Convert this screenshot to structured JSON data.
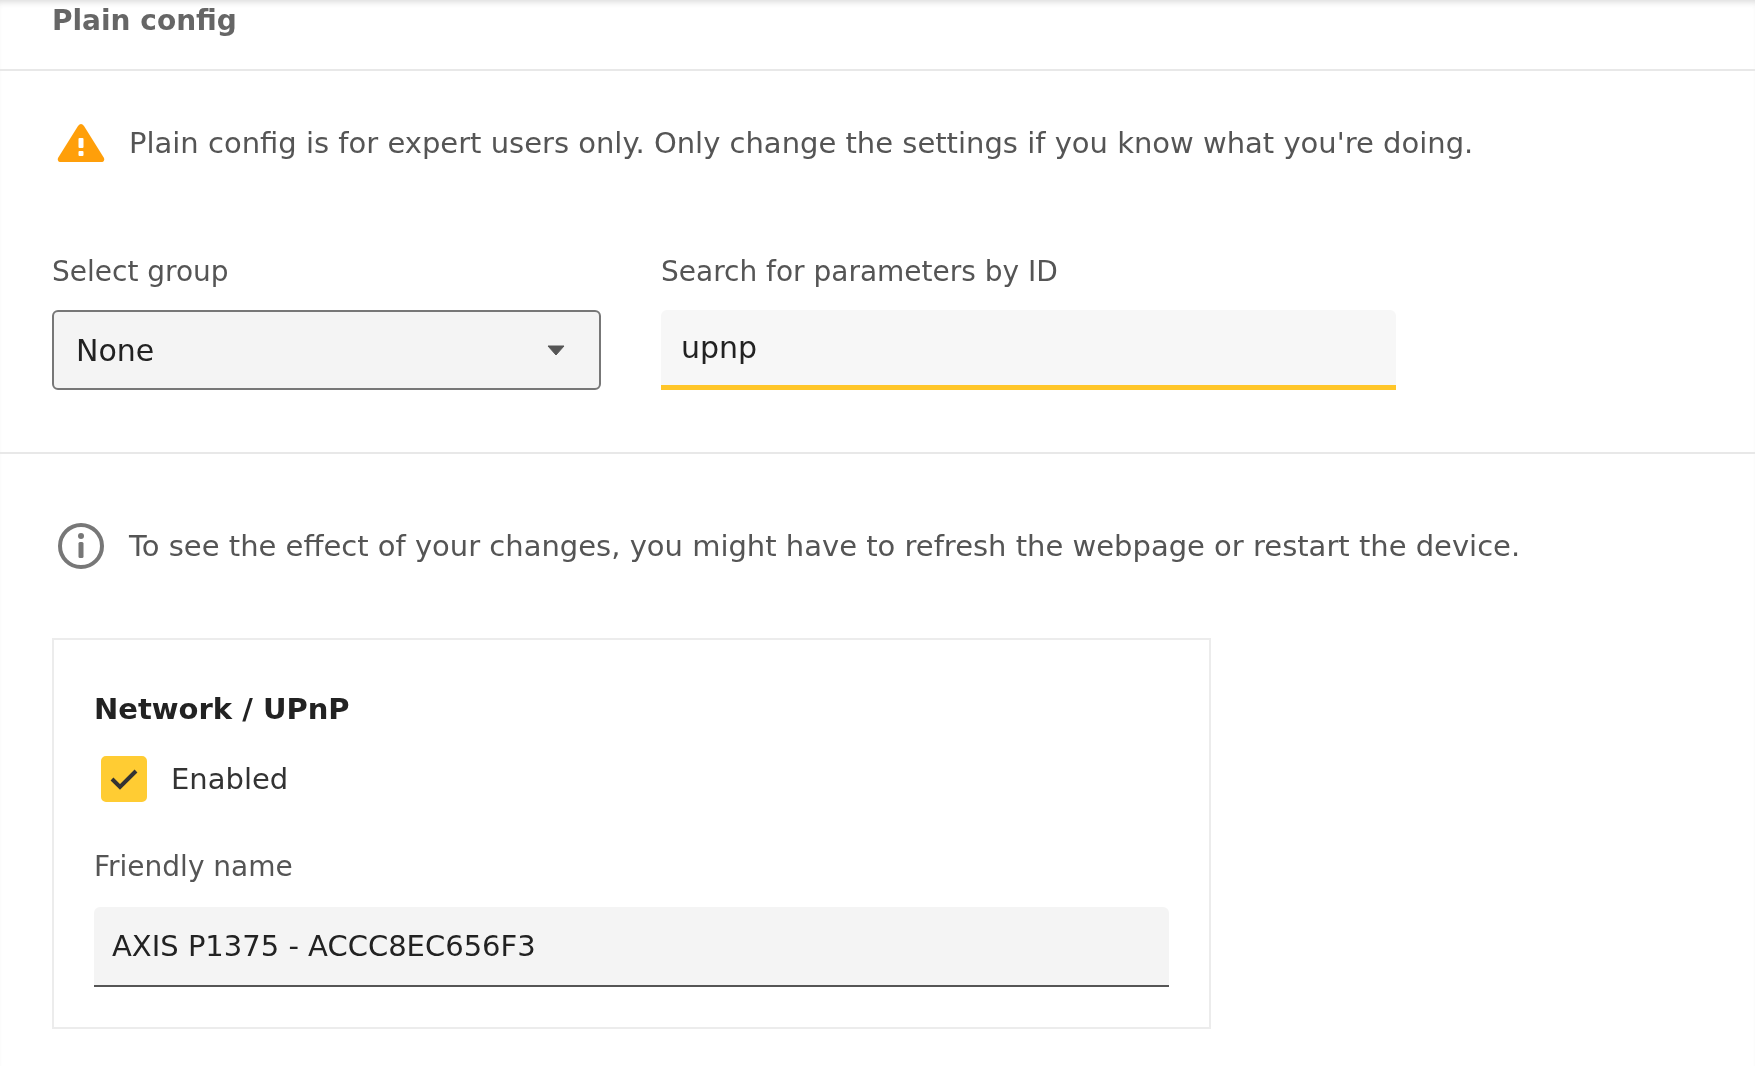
{
  "header": {
    "title": "Plain config"
  },
  "warning": {
    "text": "Plain config is for expert users only. Only change the settings if you know what you're doing."
  },
  "group_select": {
    "label": "Select group",
    "value": "None"
  },
  "search": {
    "label": "Search for parameters by ID",
    "value": "upnp",
    "focused": true
  },
  "info": {
    "text": "To see the effect of your changes, you might have to refresh the webpage or restart the device."
  },
  "section": {
    "title": "Network / UPnP",
    "fields": [
      {
        "kind": "checkbox",
        "label": "Enabled",
        "checked": true
      },
      {
        "kind": "text",
        "label": "Friendly name",
        "value": "AXIS P1375 - ACCC8EC656F3"
      }
    ]
  }
}
